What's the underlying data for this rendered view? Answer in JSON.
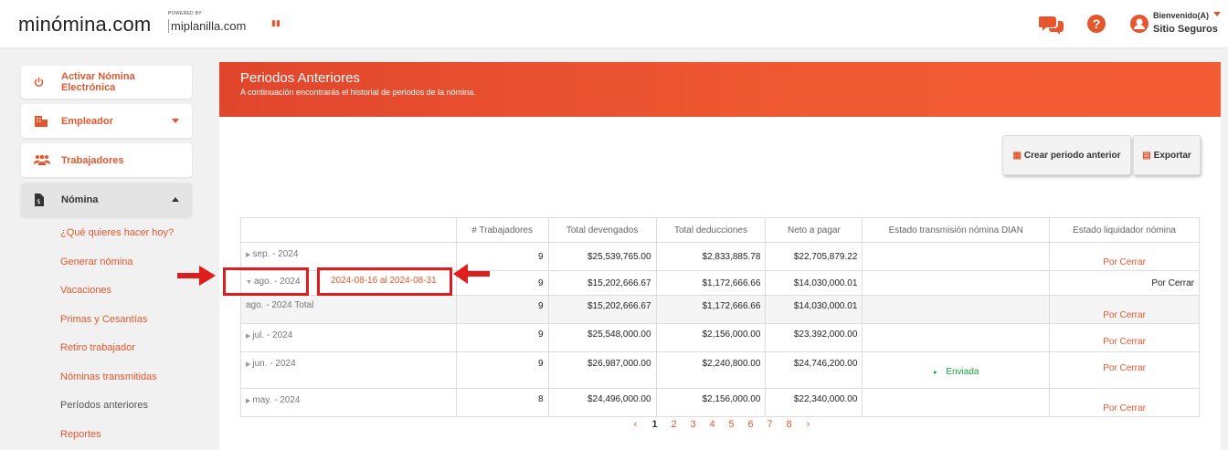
{
  "header": {
    "logo": "minómina.com",
    "powered_by": "POWERED BY",
    "partner": "miplanilla.com",
    "welcome": "Bienvenido(A)",
    "user_name": "Sitio Seguros"
  },
  "sidebar": {
    "items": [
      {
        "label": "Activar Nómina Electrónica",
        "icon": "power-icon"
      },
      {
        "label": "Empleador",
        "icon": "building-icon"
      },
      {
        "label": "Trabajadores",
        "icon": "users-icon"
      },
      {
        "label": "Nómina",
        "icon": "document-icon"
      }
    ],
    "subitems": [
      "¿Qué quieres hacer hoy?",
      "Generar nómina",
      "Vacaciones",
      "Primas y Cesantías",
      "Retiro trabajador",
      "Nóminas transmitidas",
      "Períodos anteriores",
      "Reportes"
    ]
  },
  "panel": {
    "title": "Periodos Anteriores",
    "subtitle": "A continuación encontrarás el historial de periodos de la nómina.",
    "btn_create": "Crear periodo anterior",
    "btn_export": "Exportar"
  },
  "table": {
    "headers": [
      "",
      "# Trabajadores",
      "Total devengados",
      "Total deducciones",
      "Neto a pagar",
      "Estado transmisión nómina DIAN",
      "Estado liquidador nómina"
    ],
    "rows": [
      {
        "label": "sep. - 2024",
        "workers": "9",
        "dev": "$25,539,765.00",
        "ded": "$2,833,885.78",
        "neto": "$22,705,879.22",
        "dian": "",
        "liq": "Por Cerrar"
      },
      {
        "label": "ago. - 2024",
        "workers": "9",
        "dev": "$15,202,666.67",
        "ded": "$1,172,666.66",
        "neto": "$14,030,000.01",
        "dian": "",
        "liq": "Por Cerrar"
      },
      {
        "label": "ago. - 2024 Total",
        "workers": "9",
        "dev": "$15,202,666.67",
        "ded": "$1,172,666.66",
        "neto": "$14,030,000.01",
        "dian": "",
        "liq": "Por Cerrar"
      },
      {
        "label": "jul. - 2024",
        "workers": "9",
        "dev": "$25,548,000.00",
        "ded": "$2,156,000.00",
        "neto": "$23,392,000.00",
        "dian": "",
        "liq": "Por Cerrar"
      },
      {
        "label": "jun. - 2024",
        "workers": "9",
        "dev": "$26,987,000.00",
        "ded": "$2,240,800.00",
        "neto": "$24,746,200.00",
        "dian": "Enviada",
        "liq": "Por Cerrar"
      },
      {
        "label": "may. - 2024",
        "workers": "8",
        "dev": "$24,496,000.00",
        "ded": "$2,156,000.00",
        "neto": "$22,340,000.00",
        "dian": "",
        "liq": "Por Cerrar"
      }
    ],
    "range": "2024-08-16 al 2024-08-31"
  },
  "pager": {
    "prev": "‹",
    "pages": [
      "1",
      "2",
      "3",
      "4",
      "5",
      "6",
      "7",
      "8"
    ],
    "next": "›"
  },
  "colors": {
    "accent": "#e4572e",
    "annotation": "#e01d1d",
    "ok": "#18a33a"
  }
}
